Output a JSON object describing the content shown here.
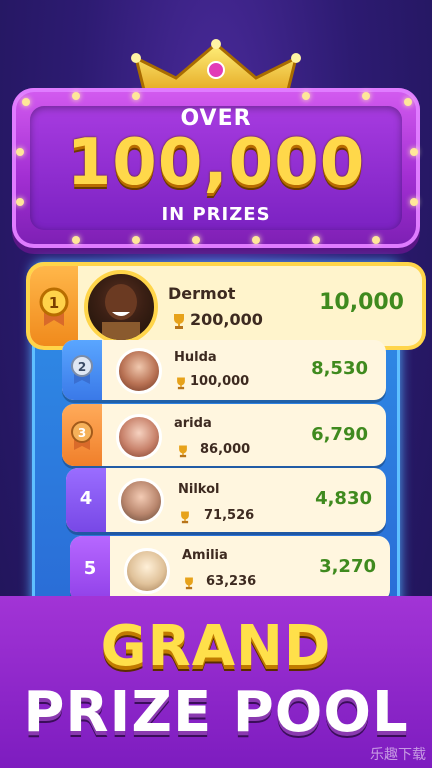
{
  "banner": {
    "over_label": "OVER",
    "amount": "100,000",
    "in_prizes_label": "IN PRIZES"
  },
  "leaderboard": [
    {
      "rank": "1",
      "name": "Dermot",
      "score": "200,000",
      "prize": "10,000",
      "badge_color": "#f4a23a"
    },
    {
      "rank": "2",
      "name": "Hulda",
      "score": "100,000",
      "prize": "8,530",
      "badge_color": "#4b97ff"
    },
    {
      "rank": "3",
      "name": "arida",
      "score": "86,000",
      "prize": "6,790",
      "badge_color": "#ff9a4a"
    },
    {
      "rank": "4",
      "name": "Nilkol",
      "score": "71,526",
      "prize": "4,830",
      "badge_color": "#8a5dff"
    },
    {
      "rank": "5",
      "name": "Amilia",
      "score": "63,236",
      "prize": "3,270",
      "badge_color": "#a24bff"
    }
  ],
  "footer": {
    "line1": "GRAND",
    "line2": "PRIZE POOL"
  },
  "watermark": "乐趣下载",
  "colors": {
    "accent_gold": "#ffd84a",
    "prize_green": "#3f8a1e",
    "banner_purple": "#a32fd3",
    "frame_blue": "#2f8fe8"
  },
  "icons": [
    "crown-icon",
    "trophy-icon",
    "rank-medal-icon"
  ]
}
